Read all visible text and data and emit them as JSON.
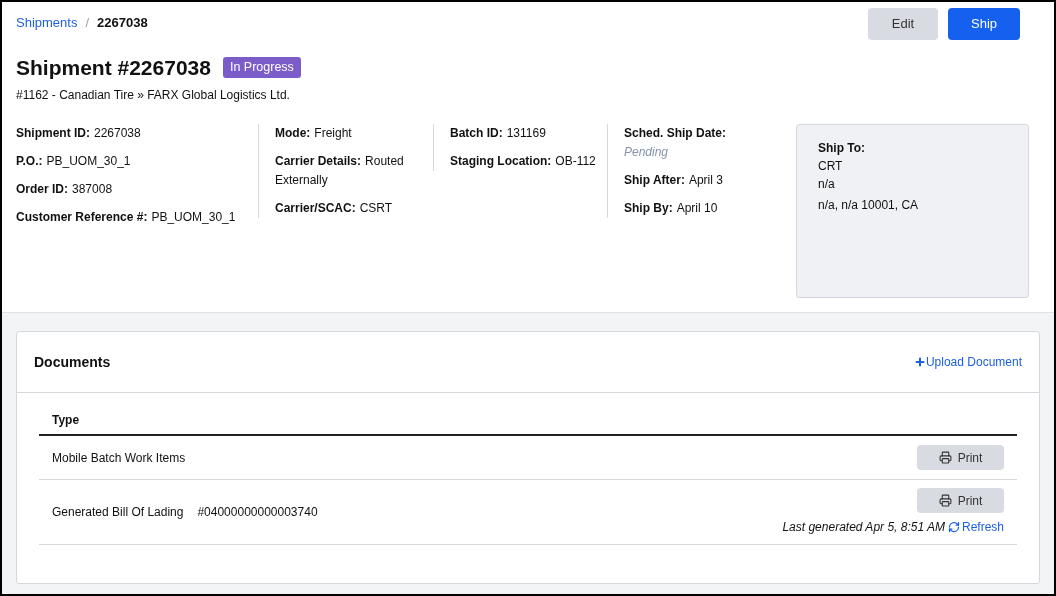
{
  "breadcrumb": {
    "link": "Shipments",
    "separator": "/",
    "current": "2267038"
  },
  "actions": [
    {
      "label": "Edit",
      "kind": "secondary"
    },
    {
      "label": "Ship",
      "kind": "primary"
    }
  ],
  "title": "Shipment #2267038",
  "status": "In Progress",
  "subtitle": "#1162 - Canadian Tire » FARX Global Logistics Ltd.",
  "columns": [
    [
      {
        "label": "Shipment ID:",
        "value": "2267038",
        "pending": false
      },
      {
        "label": "P.O.:",
        "value": "PB_UOM_30_1",
        "pending": false
      },
      {
        "label": "Order ID:",
        "value": "387008",
        "pending": false
      },
      {
        "label": "Customer Reference #:",
        "value": "PB_UOM_30_1",
        "pending": false
      }
    ],
    [
      {
        "label": "Mode:",
        "value": "Freight",
        "pending": false
      },
      {
        "label": "Carrier Details:",
        "value": "Routed Externally",
        "pending": false
      },
      {
        "label": "Carrier/SCAC:",
        "value": "CSRT",
        "pending": false
      }
    ],
    [
      {
        "label": "Batch ID:",
        "value": "131169",
        "pending": false
      },
      {
        "label": "Staging Location:",
        "value": "OB-112",
        "pending": false
      }
    ],
    [
      {
        "label": "Sched. Ship Date:",
        "value": "Pending",
        "pending": true
      },
      {
        "label": "Ship After:",
        "value": "April 3",
        "pending": false
      },
      {
        "label": "Ship By:",
        "value": "April 10",
        "pending": false
      }
    ]
  ],
  "ship_to": {
    "label": "Ship To:",
    "lines": [
      "CRT",
      "n/a",
      "n/a, n/a 10001, CA"
    ]
  },
  "documents": {
    "title": "Documents",
    "upload": "Upload Document",
    "column": "Type",
    "rows": [
      {
        "type": "Mobile Batch Work Items",
        "print": "Print"
      },
      {
        "type": "Generated Bill Of Lading",
        "number": "#04000000000003740",
        "print": "Print",
        "last_generated": "Last generated Apr 5, 8:51 AM",
        "refresh": "Refresh"
      }
    ]
  }
}
